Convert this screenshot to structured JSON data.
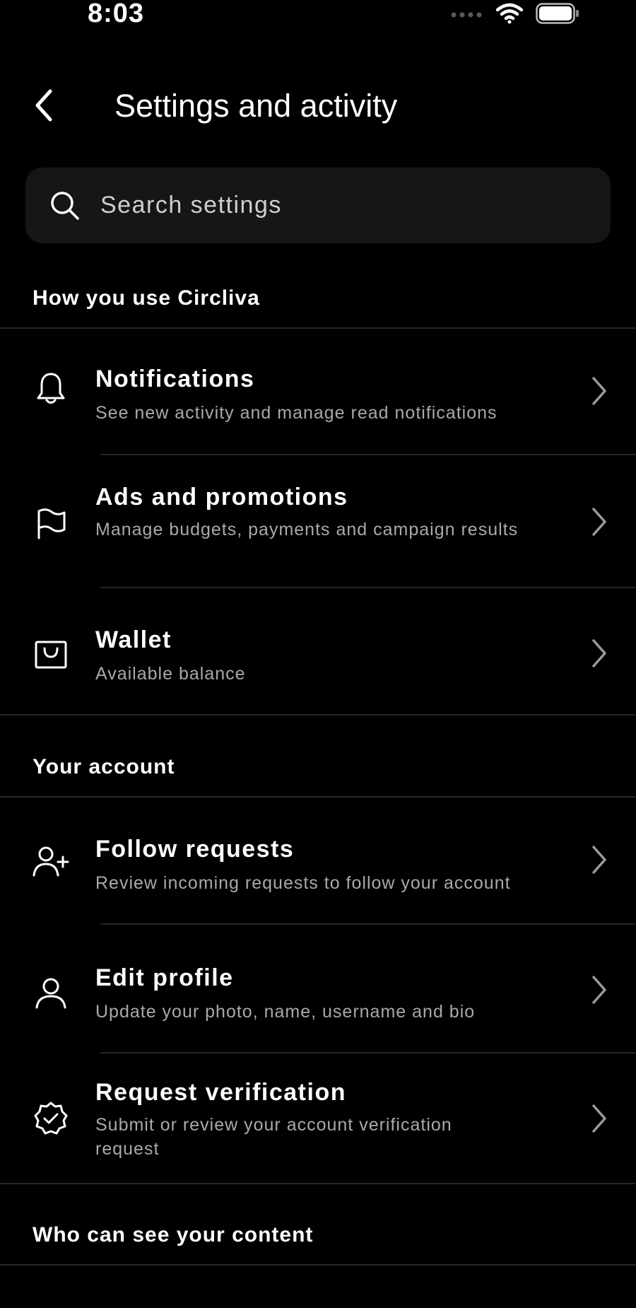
{
  "status_bar": {
    "time": "8:03"
  },
  "header": {
    "title": "Settings and activity"
  },
  "search": {
    "placeholder": "Search settings"
  },
  "sections": [
    {
      "title": "How you use Circliva",
      "items": [
        {
          "title": "Notifications",
          "subtitle": "See new activity and manage read notifications",
          "icon": "bell-icon"
        },
        {
          "title": "Ads and promotions",
          "subtitle": "Manage budgets, payments and campaign results",
          "icon": "flag-icon"
        },
        {
          "title": "Wallet",
          "subtitle": "Available balance",
          "icon": "wallet-icon"
        }
      ]
    },
    {
      "title": "Your account",
      "items": [
        {
          "title": "Follow requests",
          "subtitle": "Review incoming requests to follow your account",
          "icon": "person-plus-icon"
        },
        {
          "title": "Edit profile",
          "subtitle": "Update your photo, name, username and bio",
          "icon": "person-icon"
        },
        {
          "title": "Request verification",
          "subtitle": "Submit or review your account verification request",
          "icon": "verified-badge-icon"
        }
      ]
    },
    {
      "title": "Who can see your content",
      "items": []
    }
  ]
}
